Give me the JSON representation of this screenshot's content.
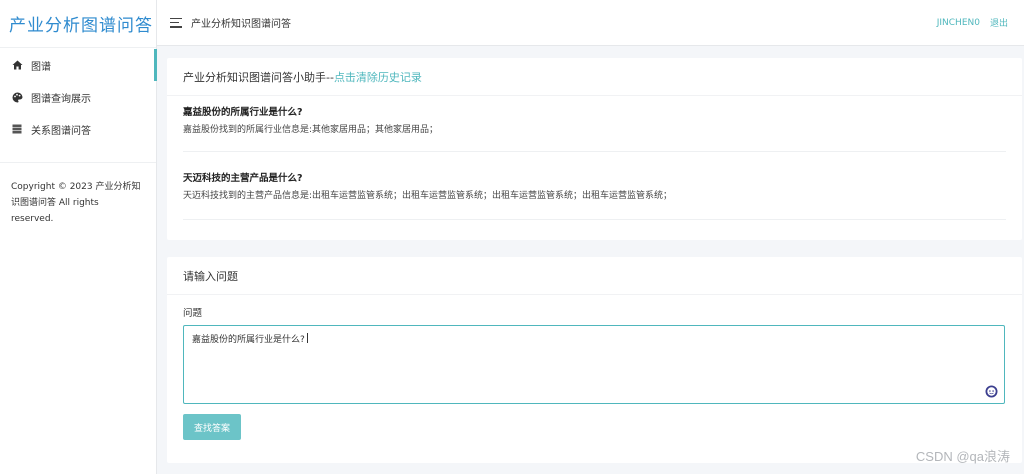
{
  "sidebar": {
    "brand": "产业分析图谱问答",
    "items": [
      {
        "label": "图谱",
        "icon": "home-icon"
      },
      {
        "label": "图谱查询展示",
        "icon": "palette-icon"
      },
      {
        "label": "关系图谱问答",
        "icon": "table-icon"
      }
    ],
    "copyright": "Copyright © 2023 产业分析知识图谱问答 All rights reserved."
  },
  "header": {
    "title": "产业分析知识图谱问答",
    "user": "JINCHEN0",
    "logout": "退出"
  },
  "history": {
    "title": "产业分析知识图谱问答小助手--",
    "clear_link": "点击清除历史记录",
    "items": [
      {
        "question": "嘉益股份的所属行业是什么?",
        "answer": "嘉益股份找到的所属行业信息是:其他家居用品；其他家居用品；"
      },
      {
        "question": "天迈科技的主营产品是什么?",
        "answer": "天迈科技找到的主营产品信息是:出租车运营监管系统；出租车运营监管系统；出租车运营监管系统；出租车运营监管系统；"
      }
    ]
  },
  "form": {
    "title": "请输入问题",
    "label": "问题",
    "value": "嘉益股份的所属行业是什么?",
    "submit": "查找答案"
  },
  "watermark": "CSDN @qa浪涛",
  "colors": {
    "accent": "#4fb7bd",
    "brand": "#2f8bcf",
    "button": "#6cc4c8",
    "background": "#f4f6f9"
  }
}
